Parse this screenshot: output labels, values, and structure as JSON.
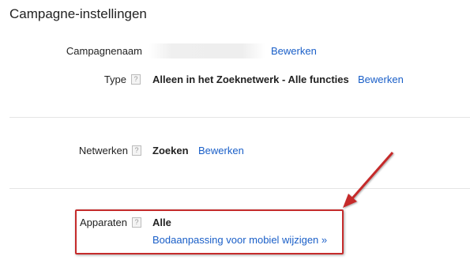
{
  "page": {
    "title": "Campagne-instellingen"
  },
  "rows": {
    "campagnenaam": {
      "label": "Campagnenaam",
      "edit": "Bewerken"
    },
    "type": {
      "label": "Type",
      "help": "?",
      "value": "Alleen in het Zoeknetwerk - Alle functies",
      "edit": "Bewerken"
    },
    "netwerken": {
      "label": "Netwerken",
      "help": "?",
      "value": "Zoeken",
      "edit": "Bewerken"
    },
    "apparaten": {
      "label": "Apparaten",
      "help": "?",
      "value": "Alle",
      "link": "Bodaanpassing voor mobiel wijzigen »"
    }
  },
  "annotation": {
    "color": "#c52b2b",
    "icon": "arrow-icon"
  }
}
